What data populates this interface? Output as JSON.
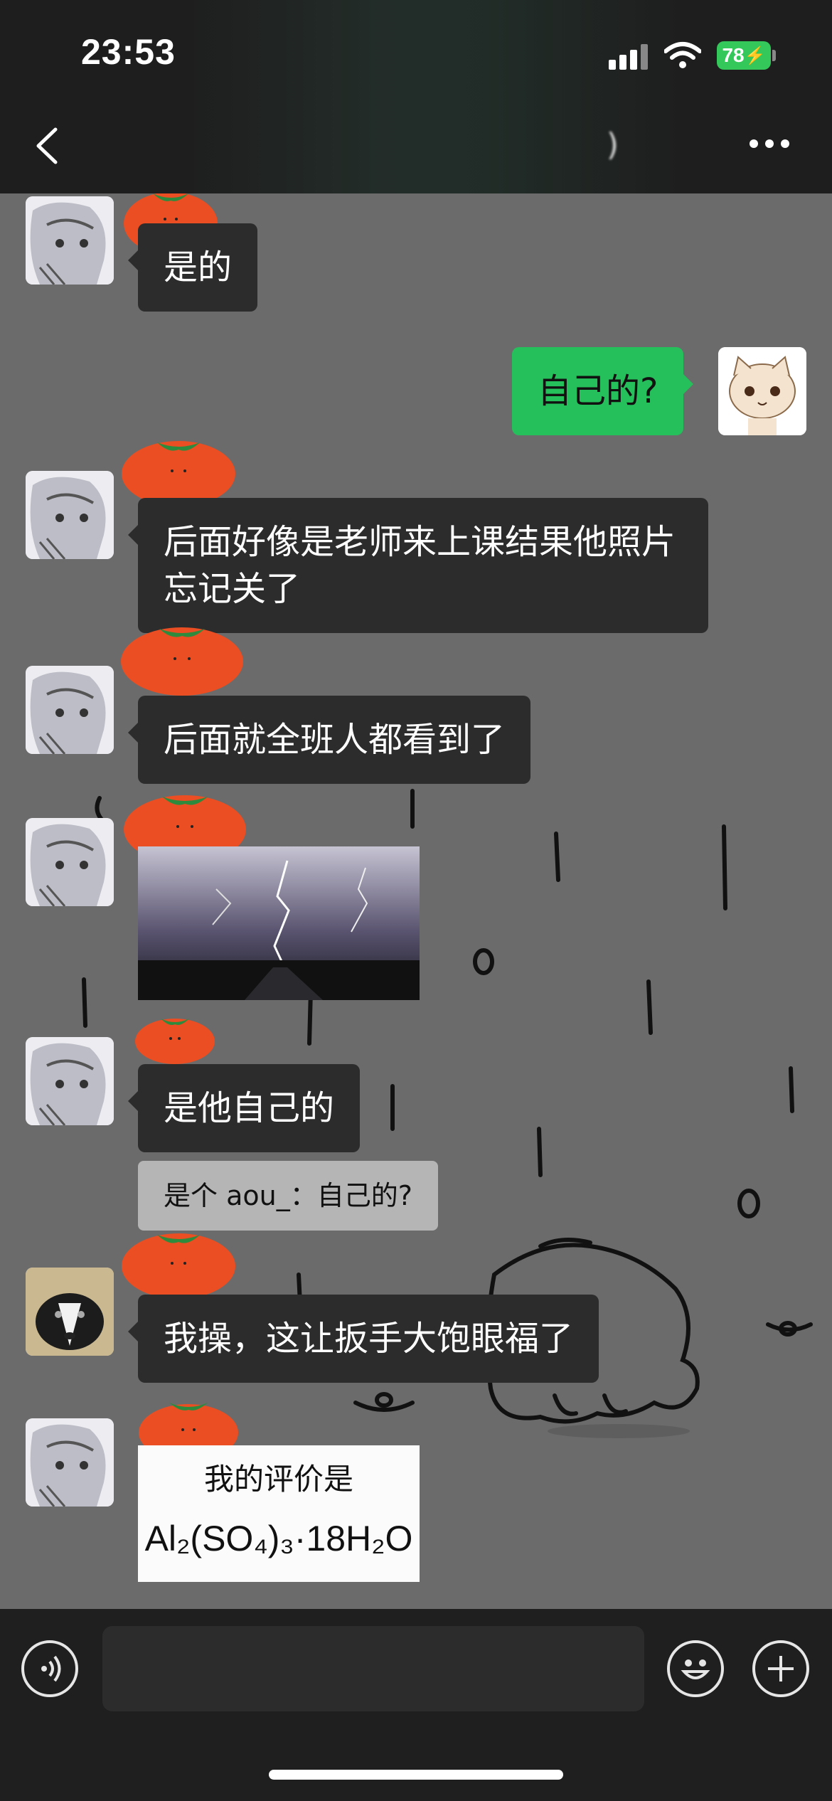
{
  "status_bar": {
    "time": "23:53",
    "battery": "78"
  },
  "nav": {
    "title": ")"
  },
  "messages": [
    {
      "text": "是的"
    },
    {
      "text": "自己的?"
    },
    {
      "text": "后面好像是老师来上课结果他照片忘记关了"
    },
    {
      "text": "后面就全班人都看到了"
    },
    {
      "text": "是他自己的"
    },
    {
      "quote": "是个 aou_：自己的?"
    },
    {
      "text": "我操，这让扳手大饱眼福了"
    },
    {
      "image_caption": "我的评价是",
      "formula": "Al₂(SO₄)₃·18H₂O"
    }
  ],
  "colors": {
    "outgoing_bubble": "#25c05b",
    "incoming_bubble": "#2c2c2c",
    "chat_background": "#6b6b6b"
  },
  "icons": [
    "back-icon",
    "more-icon",
    "voice-icon",
    "emoji-icon",
    "plus-icon",
    "wifi-icon",
    "signal-icon",
    "battery-icon",
    "tomato-sticker-icon"
  ]
}
